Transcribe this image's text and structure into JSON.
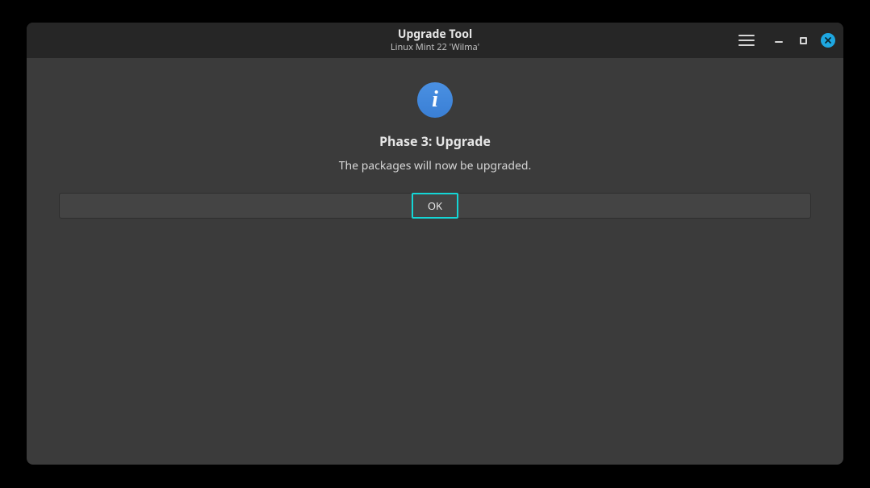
{
  "window": {
    "title": "Upgrade Tool",
    "subtitle": "Linux Mint 22 'Wilma'"
  },
  "content": {
    "info_icon_glyph": "i",
    "phase_title": "Phase 3: Upgrade",
    "phase_description": "The packages will now be upgraded.",
    "ok_label": "OK"
  }
}
